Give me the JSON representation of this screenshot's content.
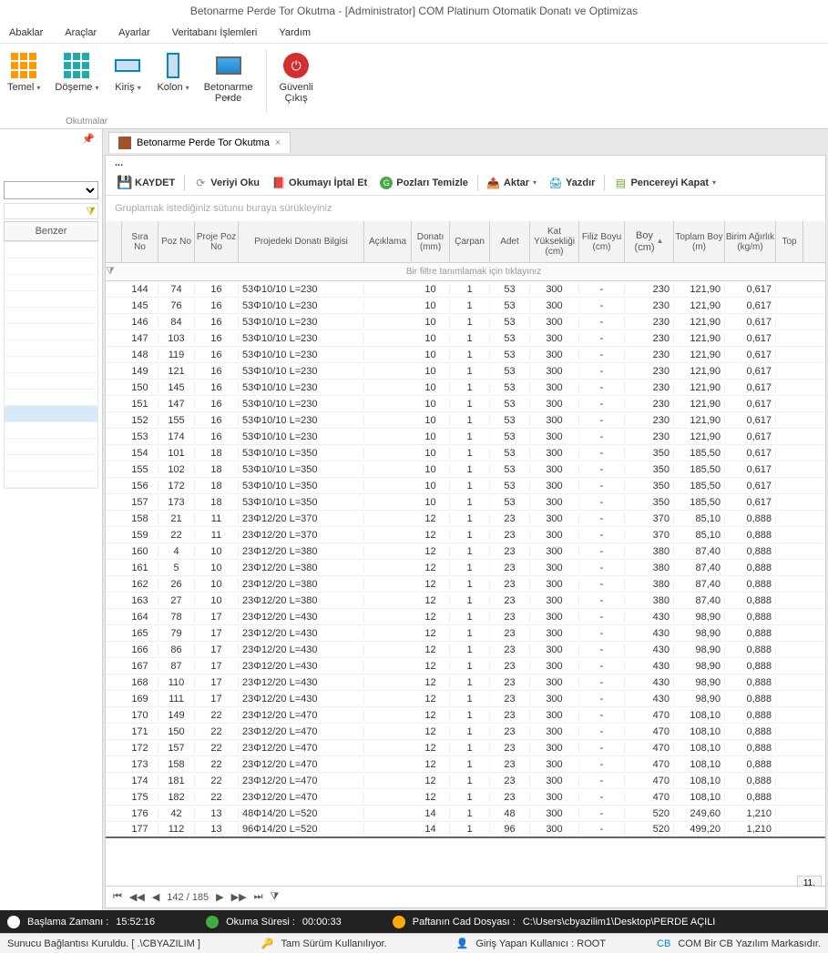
{
  "title": "Betonarme Perde Tor Okutma - [Administrator] COM Platinum Otomatik Donatı ve Optimizas",
  "menu": [
    "Abaklar",
    "Araçlar",
    "Ayarlar",
    "Veritabanı İşlemleri",
    "Yardım"
  ],
  "ribbon": {
    "buttons": [
      {
        "label": "Temel",
        "dd": true
      },
      {
        "label": "Döşeme",
        "dd": true
      },
      {
        "label": "Kiriş",
        "dd": true
      },
      {
        "label": "Kolon",
        "dd": true
      },
      {
        "label": "Betonarme\nPerde",
        "dd": true
      },
      {
        "label": "Güvenli\nÇıkış",
        "dd": false
      }
    ],
    "group_label": "Okutmalar"
  },
  "left": {
    "benzer": "Benzer"
  },
  "tab": {
    "label": "Betonarme Perde Tor Okutma"
  },
  "toolbar": {
    "kaydet": "KAYDET",
    "veriyi": "Veriyi Oku",
    "iptal": "Okumayı İptal Et",
    "pozlari": "Pozları Temizle",
    "aktar": "Aktar",
    "yazdir": "Yazdır",
    "kapat": "Pencereyi Kapat"
  },
  "group_hint": "Gruplamak istediğiniz sütunu buraya sürükleyiniz",
  "columns": [
    "Sıra\nNo",
    "Poz No",
    "Proje Poz\nNo",
    "Projedeki Donatı Bilgisi",
    "Açıklama",
    "Donatı\n(mm)",
    "Çarpan",
    "Adet",
    "Kat\nYüksekliği\n(cm)",
    "Filiz Boyu\n(cm)",
    "Boy\n(cm)",
    "Toplam Boy\n(m)",
    "Birim Ağırlık\n(kg/m)",
    "Top"
  ],
  "filter_hint": "Bir filtre tanımlamak için tıklayınız",
  "rows": [
    {
      "sira": "144",
      "poz": "74",
      "ppoz": "16",
      "bilgi": "53Φ10/10 L=230",
      "donati": "10",
      "carp": "1",
      "adet": "53",
      "kat": "300",
      "filiz": "-",
      "boy": "230",
      "tboy": "121,90",
      "birim": "0,617"
    },
    {
      "sira": "145",
      "poz": "76",
      "ppoz": "16",
      "bilgi": "53Φ10/10 L=230",
      "donati": "10",
      "carp": "1",
      "adet": "53",
      "kat": "300",
      "filiz": "-",
      "boy": "230",
      "tboy": "121,90",
      "birim": "0,617"
    },
    {
      "sira": "146",
      "poz": "84",
      "ppoz": "16",
      "bilgi": "53Φ10/10 L=230",
      "donati": "10",
      "carp": "1",
      "adet": "53",
      "kat": "300",
      "filiz": "-",
      "boy": "230",
      "tboy": "121,90",
      "birim": "0,617"
    },
    {
      "sira": "147",
      "poz": "103",
      "ppoz": "16",
      "bilgi": "53Φ10/10 L=230",
      "donati": "10",
      "carp": "1",
      "adet": "53",
      "kat": "300",
      "filiz": "-",
      "boy": "230",
      "tboy": "121,90",
      "birim": "0,617"
    },
    {
      "sira": "148",
      "poz": "119",
      "ppoz": "16",
      "bilgi": "53Φ10/10 L=230",
      "donati": "10",
      "carp": "1",
      "adet": "53",
      "kat": "300",
      "filiz": "-",
      "boy": "230",
      "tboy": "121,90",
      "birim": "0,617"
    },
    {
      "sira": "149",
      "poz": "121",
      "ppoz": "16",
      "bilgi": "53Φ10/10 L=230",
      "donati": "10",
      "carp": "1",
      "adet": "53",
      "kat": "300",
      "filiz": "-",
      "boy": "230",
      "tboy": "121,90",
      "birim": "0,617"
    },
    {
      "sira": "150",
      "poz": "145",
      "ppoz": "16",
      "bilgi": "53Φ10/10 L=230",
      "donati": "10",
      "carp": "1",
      "adet": "53",
      "kat": "300",
      "filiz": "-",
      "boy": "230",
      "tboy": "121,90",
      "birim": "0,617"
    },
    {
      "sira": "151",
      "poz": "147",
      "ppoz": "16",
      "bilgi": "53Φ10/10 L=230",
      "donati": "10",
      "carp": "1",
      "adet": "53",
      "kat": "300",
      "filiz": "-",
      "boy": "230",
      "tboy": "121,90",
      "birim": "0,617"
    },
    {
      "sira": "152",
      "poz": "155",
      "ppoz": "16",
      "bilgi": "53Φ10/10 L=230",
      "donati": "10",
      "carp": "1",
      "adet": "53",
      "kat": "300",
      "filiz": "-",
      "boy": "230",
      "tboy": "121,90",
      "birim": "0,617"
    },
    {
      "sira": "153",
      "poz": "174",
      "ppoz": "16",
      "bilgi": "53Φ10/10 L=230",
      "donati": "10",
      "carp": "1",
      "adet": "53",
      "kat": "300",
      "filiz": "-",
      "boy": "230",
      "tboy": "121,90",
      "birim": "0,617"
    },
    {
      "sira": "154",
      "poz": "101",
      "ppoz": "18",
      "bilgi": "53Φ10/10 L=350",
      "donati": "10",
      "carp": "1",
      "adet": "53",
      "kat": "300",
      "filiz": "-",
      "boy": "350",
      "tboy": "185,50",
      "birim": "0,617"
    },
    {
      "sira": "155",
      "poz": "102",
      "ppoz": "18",
      "bilgi": "53Φ10/10 L=350",
      "donati": "10",
      "carp": "1",
      "adet": "53",
      "kat": "300",
      "filiz": "-",
      "boy": "350",
      "tboy": "185,50",
      "birim": "0,617"
    },
    {
      "sira": "156",
      "poz": "172",
      "ppoz": "18",
      "bilgi": "53Φ10/10 L=350",
      "donati": "10",
      "carp": "1",
      "adet": "53",
      "kat": "300",
      "filiz": "-",
      "boy": "350",
      "tboy": "185,50",
      "birim": "0,617"
    },
    {
      "sira": "157",
      "poz": "173",
      "ppoz": "18",
      "bilgi": "53Φ10/10 L=350",
      "donati": "10",
      "carp": "1",
      "adet": "53",
      "kat": "300",
      "filiz": "-",
      "boy": "350",
      "tboy": "185,50",
      "birim": "0,617"
    },
    {
      "sira": "158",
      "poz": "21",
      "ppoz": "11",
      "bilgi": "23Φ12/20 L=370",
      "donati": "12",
      "carp": "1",
      "adet": "23",
      "kat": "300",
      "filiz": "-",
      "boy": "370",
      "tboy": "85,10",
      "birim": "0,888"
    },
    {
      "sira": "159",
      "poz": "22",
      "ppoz": "11",
      "bilgi": "23Φ12/20 L=370",
      "donati": "12",
      "carp": "1",
      "adet": "23",
      "kat": "300",
      "filiz": "-",
      "boy": "370",
      "tboy": "85,10",
      "birim": "0,888"
    },
    {
      "sira": "160",
      "poz": "4",
      "ppoz": "10",
      "bilgi": "23Φ12/20 L=380",
      "donati": "12",
      "carp": "1",
      "adet": "23",
      "kat": "300",
      "filiz": "-",
      "boy": "380",
      "tboy": "87,40",
      "birim": "0,888"
    },
    {
      "sira": "161",
      "poz": "5",
      "ppoz": "10",
      "bilgi": "23Φ12/20 L=380",
      "donati": "12",
      "carp": "1",
      "adet": "23",
      "kat": "300",
      "filiz": "-",
      "boy": "380",
      "tboy": "87,40",
      "birim": "0,888"
    },
    {
      "sira": "162",
      "poz": "26",
      "ppoz": "10",
      "bilgi": "23Φ12/20 L=380",
      "donati": "12",
      "carp": "1",
      "adet": "23",
      "kat": "300",
      "filiz": "-",
      "boy": "380",
      "tboy": "87,40",
      "birim": "0,888"
    },
    {
      "sira": "163",
      "poz": "27",
      "ppoz": "10",
      "bilgi": "23Φ12/20 L=380",
      "donati": "12",
      "carp": "1",
      "adet": "23",
      "kat": "300",
      "filiz": "-",
      "boy": "380",
      "tboy": "87,40",
      "birim": "0,888"
    },
    {
      "sira": "164",
      "poz": "78",
      "ppoz": "17",
      "bilgi": "23Φ12/20 L=430",
      "donati": "12",
      "carp": "1",
      "adet": "23",
      "kat": "300",
      "filiz": "-",
      "boy": "430",
      "tboy": "98,90",
      "birim": "0,888"
    },
    {
      "sira": "165",
      "poz": "79",
      "ppoz": "17",
      "bilgi": "23Φ12/20 L=430",
      "donati": "12",
      "carp": "1",
      "adet": "23",
      "kat": "300",
      "filiz": "-",
      "boy": "430",
      "tboy": "98,90",
      "birim": "0,888"
    },
    {
      "sira": "166",
      "poz": "86",
      "ppoz": "17",
      "bilgi": "23Φ12/20 L=430",
      "donati": "12",
      "carp": "1",
      "adet": "23",
      "kat": "300",
      "filiz": "-",
      "boy": "430",
      "tboy": "98,90",
      "birim": "0,888"
    },
    {
      "sira": "167",
      "poz": "87",
      "ppoz": "17",
      "bilgi": "23Φ12/20 L=430",
      "donati": "12",
      "carp": "1",
      "adet": "23",
      "kat": "300",
      "filiz": "-",
      "boy": "430",
      "tboy": "98,90",
      "birim": "0,888"
    },
    {
      "sira": "168",
      "poz": "110",
      "ppoz": "17",
      "bilgi": "23Φ12/20 L=430",
      "donati": "12",
      "carp": "1",
      "adet": "23",
      "kat": "300",
      "filiz": "-",
      "boy": "430",
      "tboy": "98,90",
      "birim": "0,888"
    },
    {
      "sira": "169",
      "poz": "111",
      "ppoz": "17",
      "bilgi": "23Φ12/20 L=430",
      "donati": "12",
      "carp": "1",
      "adet": "23",
      "kat": "300",
      "filiz": "-",
      "boy": "430",
      "tboy": "98,90",
      "birim": "0,888"
    },
    {
      "sira": "170",
      "poz": "149",
      "ppoz": "22",
      "bilgi": "23Φ12/20 L=470",
      "donati": "12",
      "carp": "1",
      "adet": "23",
      "kat": "300",
      "filiz": "-",
      "boy": "470",
      "tboy": "108,10",
      "birim": "0,888"
    },
    {
      "sira": "171",
      "poz": "150",
      "ppoz": "22",
      "bilgi": "23Φ12/20 L=470",
      "donati": "12",
      "carp": "1",
      "adet": "23",
      "kat": "300",
      "filiz": "-",
      "boy": "470",
      "tboy": "108,10",
      "birim": "0,888"
    },
    {
      "sira": "172",
      "poz": "157",
      "ppoz": "22",
      "bilgi": "23Φ12/20 L=470",
      "donati": "12",
      "carp": "1",
      "adet": "23",
      "kat": "300",
      "filiz": "-",
      "boy": "470",
      "tboy": "108,10",
      "birim": "0,888"
    },
    {
      "sira": "173",
      "poz": "158",
      "ppoz": "22",
      "bilgi": "23Φ12/20 L=470",
      "donati": "12",
      "carp": "1",
      "adet": "23",
      "kat": "300",
      "filiz": "-",
      "boy": "470",
      "tboy": "108,10",
      "birim": "0,888"
    },
    {
      "sira": "174",
      "poz": "181",
      "ppoz": "22",
      "bilgi": "23Φ12/20 L=470",
      "donati": "12",
      "carp": "1",
      "adet": "23",
      "kat": "300",
      "filiz": "-",
      "boy": "470",
      "tboy": "108,10",
      "birim": "0,888"
    },
    {
      "sira": "175",
      "poz": "182",
      "ppoz": "22",
      "bilgi": "23Φ12/20 L=470",
      "donati": "12",
      "carp": "1",
      "adet": "23",
      "kat": "300",
      "filiz": "-",
      "boy": "470",
      "tboy": "108,10",
      "birim": "0,888"
    },
    {
      "sira": "176",
      "poz": "42",
      "ppoz": "13",
      "bilgi": "48Φ14/20 L=520",
      "donati": "14",
      "carp": "1",
      "adet": "48",
      "kat": "300",
      "filiz": "-",
      "boy": "520",
      "tboy": "249,60",
      "birim": "1,210"
    },
    {
      "sira": "177",
      "poz": "112",
      "ppoz": "13",
      "bilgi": "96Φ14/20 L=520",
      "donati": "14",
      "carp": "1",
      "adet": "96",
      "kat": "300",
      "filiz": "-",
      "boy": "520",
      "tboy": "499,20",
      "birim": "1,210"
    }
  ],
  "footer_sum": "11,",
  "pager": {
    "record": "142 / 185"
  },
  "status1": {
    "baslama": "Başlama Zamanı :",
    "baslama_v": "15:52:16",
    "okuma": "Okuma Süresi :",
    "okuma_v": "00:00:33",
    "pafta": "Paftanın Cad Dosyası :",
    "pafta_v": "C:\\Users\\cbyazilim1\\Desktop\\PERDE AÇILI"
  },
  "status2": {
    "sunucu": "Sunucu Bağlantısı Kuruldu. [ .\\CBYAZILIM ]",
    "tam": "Tam Sürüm Kullanılıyor.",
    "giris": "Giriş Yapan Kullanıcı : ROOT",
    "marka": "COM Bir CB Yazılım Markasıdır."
  }
}
